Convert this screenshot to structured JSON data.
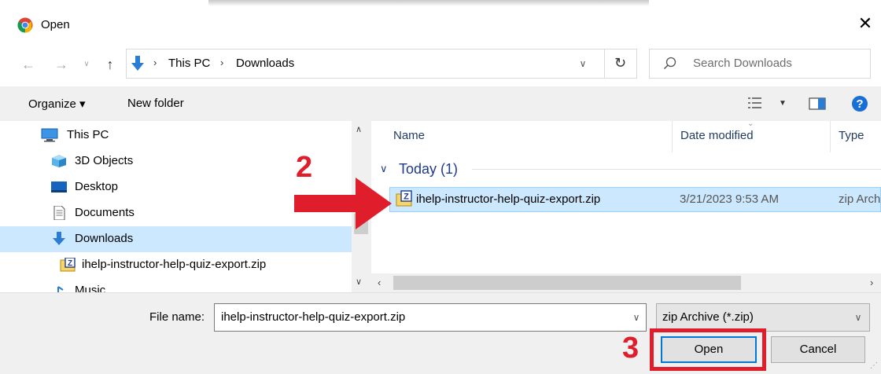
{
  "window": {
    "title": "Open"
  },
  "address": {
    "path": [
      "This PC",
      "Downloads"
    ],
    "search_placeholder": "Search Downloads"
  },
  "toolbar": {
    "organize_label": "Organize ▾",
    "new_folder_label": "New folder"
  },
  "nav": {
    "items": [
      {
        "label": "This PC",
        "icon": "computer-icon"
      },
      {
        "label": "3D Objects",
        "icon": "3d-objects-icon"
      },
      {
        "label": "Desktop",
        "icon": "desktop-icon"
      },
      {
        "label": "Documents",
        "icon": "documents-icon"
      },
      {
        "label": "Downloads",
        "icon": "downloads-icon",
        "selected": true
      },
      {
        "label": "ihelp-instructor-help-quiz-export.zip",
        "icon": "zip-icon"
      },
      {
        "label": "Music",
        "icon": "music-icon"
      }
    ]
  },
  "files": {
    "columns": [
      "Name",
      "Date modified",
      "Type"
    ],
    "group": "Today (1)",
    "rows": [
      {
        "name": "ihelp-instructor-help-quiz-export.zip",
        "date": "3/21/2023 9:53 AM",
        "type": "zip Arch"
      }
    ]
  },
  "footer": {
    "file_name_label": "File name:",
    "file_name_value": "ihelp-instructor-help-quiz-export.zip",
    "filter_value": "zip Archive (*.zip)",
    "open_label": "Open",
    "cancel_label": "Cancel"
  },
  "annotations": {
    "step2": "2",
    "step3": "3",
    "highlight_color": "#e01d2a"
  }
}
